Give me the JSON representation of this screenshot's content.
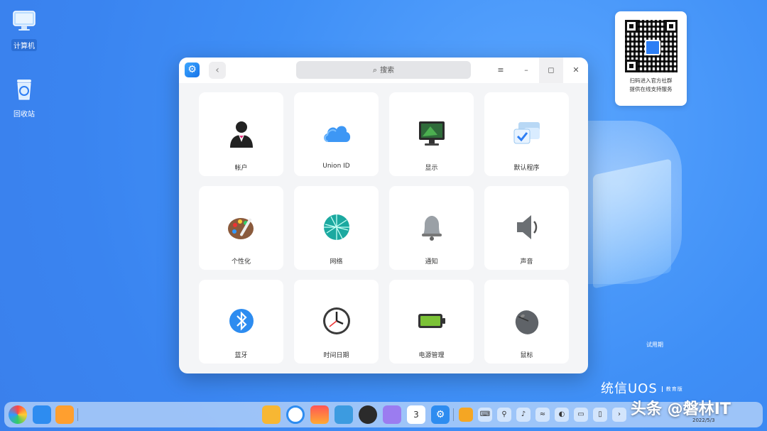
{
  "desktop": {
    "icons": [
      {
        "label": "计算机",
        "icon": "computer-icon"
      },
      {
        "label": "回收站",
        "icon": "trash-icon"
      }
    ],
    "qr_card": {
      "line1": "扫码进入官方社群",
      "line2": "提供在线支持服务"
    },
    "trial_text": "试用期",
    "brand": {
      "name": "统信UOS",
      "edition": "教育版"
    }
  },
  "window": {
    "search_placeholder": "搜索",
    "back_icon": "‹",
    "menu_icon": "≡",
    "minimize_icon": "–",
    "maximize_icon": "◻",
    "close_icon": "✕",
    "items": [
      {
        "label": "帐户",
        "icon": "account-icon"
      },
      {
        "label": "Union ID",
        "icon": "cloud-icon"
      },
      {
        "label": "显示",
        "icon": "display-icon"
      },
      {
        "label": "默认程序",
        "icon": "default-apps-icon"
      },
      {
        "label": "个性化",
        "icon": "palette-icon"
      },
      {
        "label": "网络",
        "icon": "network-icon"
      },
      {
        "label": "通知",
        "icon": "bell-icon"
      },
      {
        "label": "声音",
        "icon": "speaker-icon"
      },
      {
        "label": "蓝牙",
        "icon": "bluetooth-icon"
      },
      {
        "label": "时间日期",
        "icon": "clock-icon"
      },
      {
        "label": "电源管理",
        "icon": "battery-icon"
      },
      {
        "label": "鼠标",
        "icon": "mouse-icon"
      }
    ]
  },
  "dock": {
    "calendar_day": "3",
    "date": "2022/5/3",
    "watermark": "头条 @磐林IT"
  }
}
